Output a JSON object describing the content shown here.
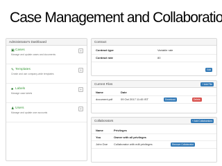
{
  "slide_title": "Case Management and Collaboration",
  "dashboard": {
    "title": "Administrator's Dashboard",
    "items": [
      {
        "icon": "▣",
        "name": "Cases",
        "desc": "Manage and update cases and documents"
      },
      {
        "icon": "✎",
        "name": "Templates",
        "desc": "Create and use company-wide templates"
      },
      {
        "icon": "♣",
        "name": "Labels",
        "desc": "Manage case labels"
      },
      {
        "icon": "♟",
        "name": "Users",
        "desc": "Manage and update user accounts"
      }
    ],
    "add_symbol": "+"
  },
  "contract": {
    "title": "Contract",
    "rows": [
      {
        "label": "Contract type",
        "value": "Variable rate"
      },
      {
        "label": "Contract rate",
        "value": "80"
      }
    ],
    "edit_label": "Edit"
  },
  "files": {
    "title": "Current Files",
    "add_label": "+ Add File",
    "headers": [
      "Name",
      "Date"
    ],
    "rows": [
      {
        "name": "document.pdf",
        "date": "09 Oct 2017 11:45 IST",
        "download": "Download",
        "delete": "Delete"
      }
    ]
  },
  "collaborators": {
    "title": "Collaborators",
    "add_label": "+ Add Collaborators",
    "headers": [
      "Name",
      "Privileges"
    ],
    "rows": [
      {
        "name": "You",
        "priv": "Owner with all privileges",
        "bold": true
      },
      {
        "name": "John Doe",
        "priv": "Collaborator with edit privileges",
        "bold": false,
        "action": "Remove Collaborator"
      }
    ]
  }
}
